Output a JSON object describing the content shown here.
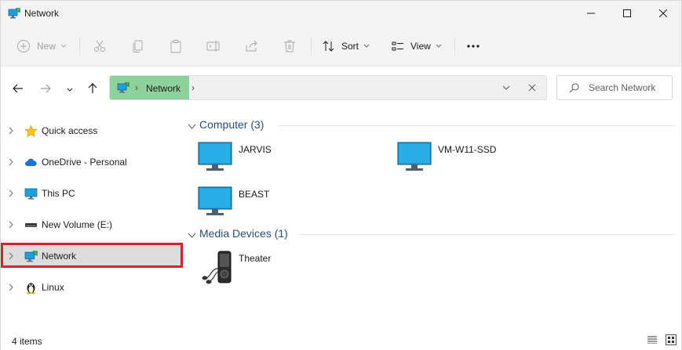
{
  "window": {
    "title": "Network"
  },
  "toolbar": {
    "new_label": "New",
    "sort_label": "Sort",
    "view_label": "View",
    "more_label": "•••"
  },
  "address": {
    "separator": "›",
    "location": "Network",
    "search_placeholder": "Search Network"
  },
  "sidebar": {
    "items": [
      {
        "label": "Quick access"
      },
      {
        "label": "OneDrive - Personal"
      },
      {
        "label": "This PC"
      },
      {
        "label": "New Volume (E:)"
      },
      {
        "label": "Network"
      },
      {
        "label": "Linux"
      }
    ]
  },
  "groups": {
    "computer": {
      "header": "Computer (3)",
      "items": [
        {
          "label": "JARVIS"
        },
        {
          "label": "VM-W11-SSD"
        },
        {
          "label": "BEAST"
        }
      ]
    },
    "media": {
      "header": "Media Devices (1)",
      "items": [
        {
          "label": "Theater"
        }
      ]
    }
  },
  "status": {
    "item_count": "4 items"
  },
  "colors": {
    "address_highlight": "#8fd19a",
    "selection_outline": "#d3232e",
    "group_header": "#2a4c7a",
    "monitor": "#1e9fd8"
  }
}
